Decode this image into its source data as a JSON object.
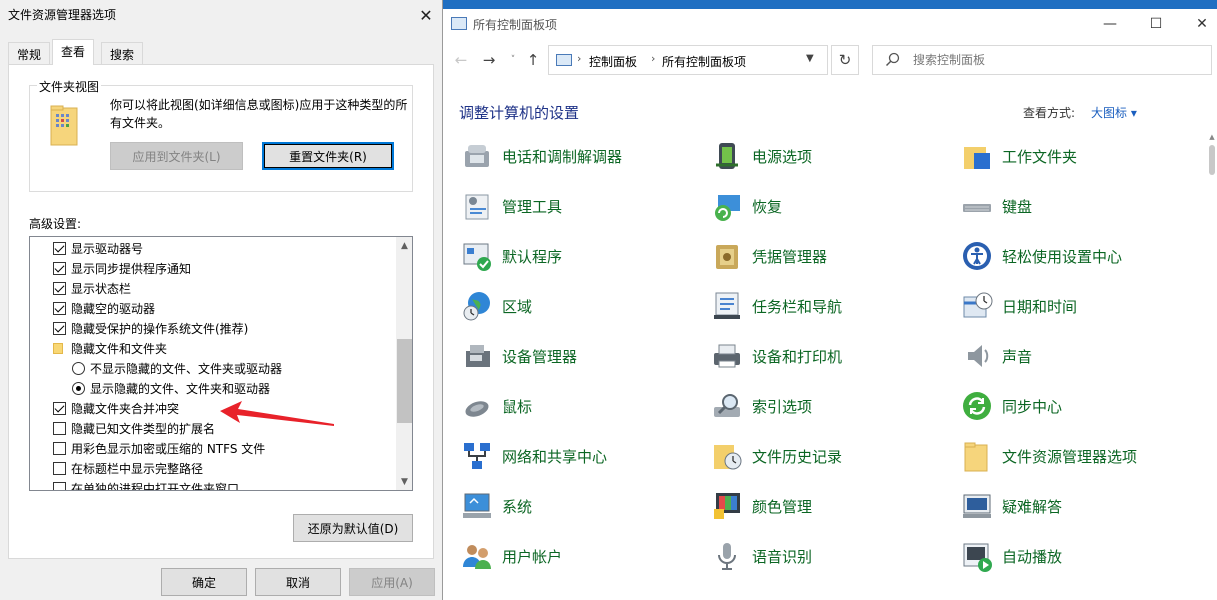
{
  "dialog": {
    "title": "文件资源管理器选项",
    "tabs": [
      "常规",
      "查看",
      "搜索"
    ],
    "group_title": "文件夹视图",
    "group_desc": "你可以将此视图(如详细信息或图标)应用于这种类型的所有文件夹。",
    "apply_to_folders": "应用到文件夹(L)",
    "reset_folders": "重置文件夹(R)",
    "advanced_label": "高级设置:",
    "advanced_items": [
      {
        "type": "checkbox",
        "checked": true,
        "label": "显示驱动器号"
      },
      {
        "type": "checkbox",
        "checked": true,
        "label": "显示同步提供程序通知"
      },
      {
        "type": "checkbox",
        "checked": true,
        "label": "显示状态栏"
      },
      {
        "type": "checkbox",
        "checked": true,
        "label": "隐藏空的驱动器"
      },
      {
        "type": "checkbox",
        "checked": true,
        "label": "隐藏受保护的操作系统文件(推荐)"
      },
      {
        "type": "folder",
        "checked": false,
        "label": "隐藏文件和文件夹"
      },
      {
        "type": "radio",
        "checked": false,
        "label": "不显示隐藏的文件、文件夹或驱动器"
      },
      {
        "type": "radio",
        "checked": true,
        "label": "显示隐藏的文件、文件夹和驱动器"
      },
      {
        "type": "checkbox",
        "checked": true,
        "label": "隐藏文件夹合并冲突"
      },
      {
        "type": "checkbox",
        "checked": false,
        "label": "隐藏已知文件类型的扩展名"
      },
      {
        "type": "checkbox",
        "checked": false,
        "label": "用彩色显示加密或压缩的 NTFS 文件"
      },
      {
        "type": "checkbox",
        "checked": false,
        "label": "在标题栏中显示完整路径"
      },
      {
        "type": "checkbox",
        "checked": false,
        "label": "在单独的进程中打开文件夹窗口"
      }
    ],
    "restore_defaults": "还原为默认值(D)",
    "ok": "确定",
    "cancel": "取消",
    "apply": "应用(A)"
  },
  "control_panel": {
    "title": "所有控制面板项",
    "breadcrumb": [
      "控制面板",
      "所有控制面板项"
    ],
    "search_placeholder": "搜索控制面板",
    "heading": "调整计算机的设置",
    "view_by_label": "查看方式:",
    "view_by_value": "大图标 ▾",
    "items": [
      {
        "label": "电话和调制解调器",
        "icon": "phone-modem-icon"
      },
      {
        "label": "电源选项",
        "icon": "power-options-icon"
      },
      {
        "label": "工作文件夹",
        "icon": "work-folders-icon"
      },
      {
        "label": "管理工具",
        "icon": "admin-tools-icon"
      },
      {
        "label": "恢复",
        "icon": "recovery-icon"
      },
      {
        "label": "键盘",
        "icon": "keyboard-icon"
      },
      {
        "label": "默认程序",
        "icon": "default-programs-icon"
      },
      {
        "label": "凭据管理器",
        "icon": "credential-manager-icon"
      },
      {
        "label": "轻松使用设置中心",
        "icon": "ease-of-access-icon"
      },
      {
        "label": "区域",
        "icon": "region-icon"
      },
      {
        "label": "任务栏和导航",
        "icon": "taskbar-icon"
      },
      {
        "label": "日期和时间",
        "icon": "date-time-icon"
      },
      {
        "label": "设备管理器",
        "icon": "device-manager-icon"
      },
      {
        "label": "设备和打印机",
        "icon": "devices-printers-icon"
      },
      {
        "label": "声音",
        "icon": "sound-icon"
      },
      {
        "label": "鼠标",
        "icon": "mouse-icon"
      },
      {
        "label": "索引选项",
        "icon": "indexing-icon"
      },
      {
        "label": "同步中心",
        "icon": "sync-center-icon"
      },
      {
        "label": "网络和共享中心",
        "icon": "network-sharing-icon"
      },
      {
        "label": "文件历史记录",
        "icon": "file-history-icon"
      },
      {
        "label": "文件资源管理器选项",
        "icon": "explorer-options-icon"
      },
      {
        "label": "系统",
        "icon": "system-icon"
      },
      {
        "label": "颜色管理",
        "icon": "color-management-icon"
      },
      {
        "label": "疑难解答",
        "icon": "troubleshooting-icon"
      },
      {
        "label": "用户帐户",
        "icon": "user-accounts-icon"
      },
      {
        "label": "语音识别",
        "icon": "speech-recognition-icon"
      },
      {
        "label": "自动播放",
        "icon": "autoplay-icon"
      }
    ]
  }
}
